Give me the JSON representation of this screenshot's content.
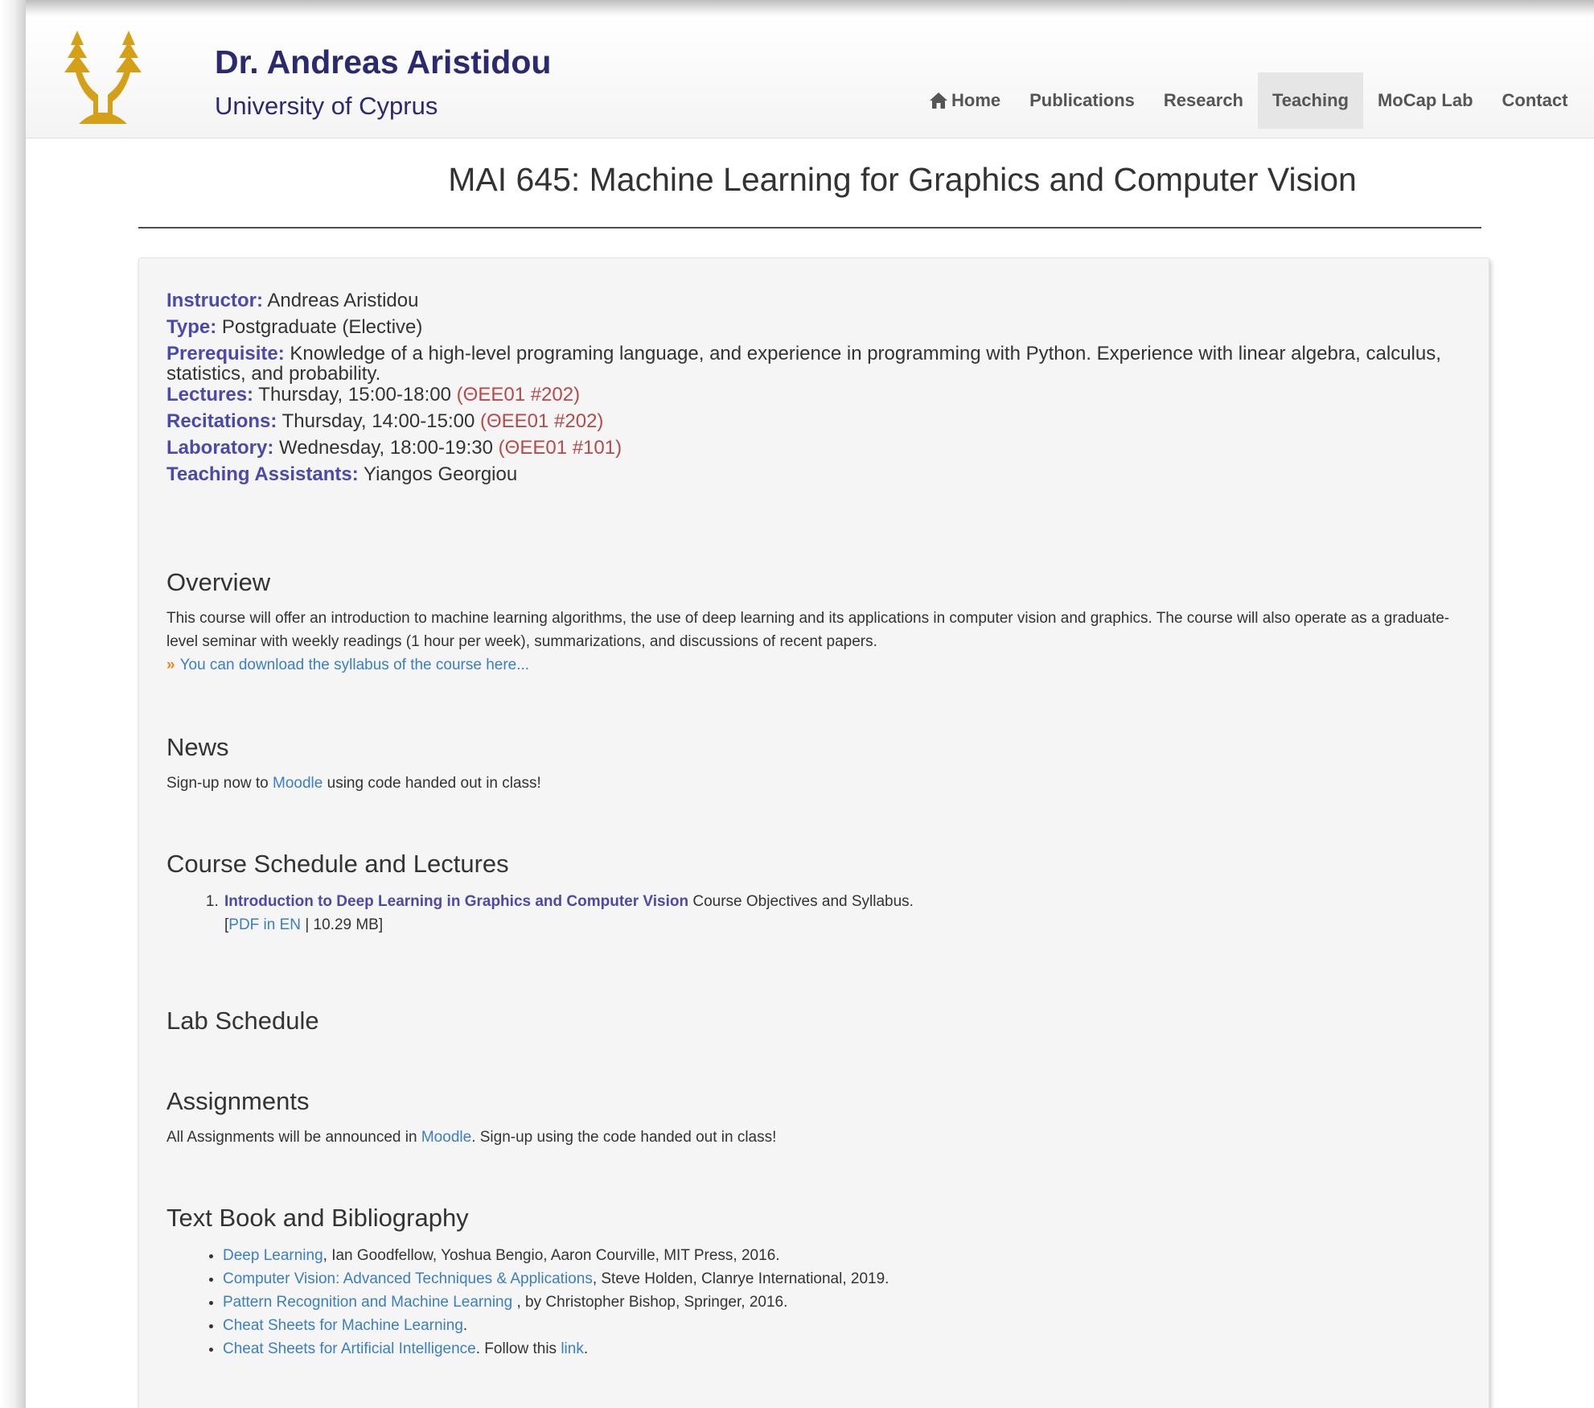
{
  "header": {
    "name": "Dr. Andreas Aristidou",
    "affiliation": "University of Cyprus",
    "logo_color": "#d4a017"
  },
  "nav": {
    "items": [
      {
        "label": "Home",
        "icon": "home-icon",
        "active": false
      },
      {
        "label": "Publications",
        "active": false
      },
      {
        "label": "Research",
        "active": false
      },
      {
        "label": "Teaching",
        "active": true
      },
      {
        "label": "MoCap Lab",
        "active": false
      },
      {
        "label": "Contact",
        "active": false
      }
    ]
  },
  "page": {
    "title": "MAI 645: Machine Learning for Graphics and Computer Vision"
  },
  "info": {
    "instructor_label": "Instructor:",
    "instructor": "Andreas Aristidou",
    "type_label": "Type:",
    "type": "Postgraduate (Elective)",
    "prereq_label": "Prerequisite:",
    "prereq": "Knowledge of a high-level programing language, and experience in programming with Python. Experience with linear algebra, calculus, statistics, and probability.",
    "lectures_label": "Lectures:",
    "lectures": "Thursday, 15:00-18:00",
    "lectures_room": "(ΘΕΕ01 #202)",
    "recitations_label": "Recitations:",
    "recitations": "Thursday, 14:00-15:00",
    "recitations_room": "(ΘΕΕ01 #202)",
    "lab_label": "Laboratory:",
    "lab": "Wednesday, 18:00-19:30",
    "lab_room": "(ΘΕΕ01 #101)",
    "ta_label": "Teaching Assistants:",
    "ta": "Yiangos Georgiou"
  },
  "overview": {
    "title": "Overview",
    "text": "This course will offer an introduction to machine learning algorithms, the use of deep learning and its applications in computer vision and graphics. The course will also operate as a graduate-level seminar with weekly readings (1 hour per week), summarizations, and discussions of recent papers.",
    "marker": "»",
    "syllabus_link": "You can download the syllabus of the course here..."
  },
  "news": {
    "title": "News",
    "before": "Sign-up now to",
    "link": "Moodle",
    "after": "using code handed out in class!"
  },
  "schedule": {
    "title": "Course Schedule and Lectures",
    "lectures": [
      {
        "title": "Introduction to Deep Learning in Graphics and Computer Vision",
        "desc": "Course Objectives and Syllabus.",
        "bracket_open": "[",
        "pdf_link": "PDF in EN",
        "size": "| 10.29 MB]"
      }
    ]
  },
  "lab_schedule": {
    "title": "Lab Schedule"
  },
  "assignments": {
    "title": "Assignments",
    "before": "All Assignments will be announced in",
    "link": "Moodle",
    "after": ". Sign-up using the code handed out in class!"
  },
  "bibliography": {
    "title": "Text Book and Bibliography",
    "items": [
      {
        "link": "Deep Learning",
        "rest": ", Ian Goodfellow, Yoshua Bengio, Aaron Courville, MIT Press, 2016."
      },
      {
        "link": "Computer Vision: Advanced Techniques & Applications",
        "rest": ", Steve Holden, Clanrye International, 2019."
      },
      {
        "link": "Pattern Recognition and Machine Learning",
        "rest": " , by Christopher Bishop, Springer, 2016."
      },
      {
        "link": "Cheat Sheets for Machine Learning",
        "rest": "."
      },
      {
        "link": "Cheat Sheets for Artificial Intelligence",
        "rest": ". Follow this ",
        "link2": "link",
        "rest2": "."
      }
    ]
  }
}
